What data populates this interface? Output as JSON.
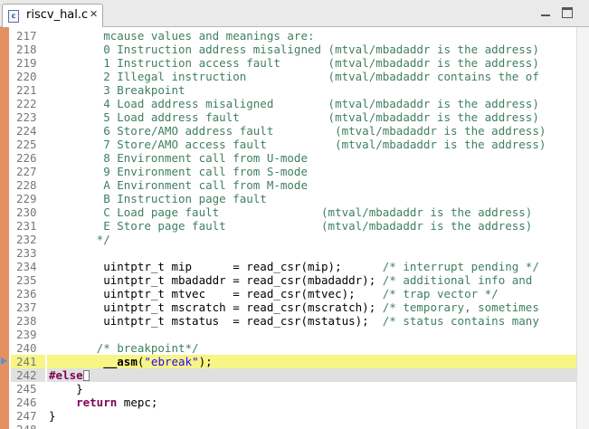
{
  "tab": {
    "title": "riscv_hal.c",
    "close_glyph": "✕"
  },
  "window": {
    "minimize": "minimize-icon",
    "maximize": "maximize-icon"
  },
  "editor": {
    "lines": [
      {
        "num": "217",
        "spans": [
          {
            "t": "        mcause values and meanings are:",
            "c": "comment"
          }
        ]
      },
      {
        "num": "218",
        "spans": [
          {
            "t": "        0 Instruction address misaligned (mtval/mbadaddr is the address)",
            "c": "comment"
          }
        ]
      },
      {
        "num": "219",
        "spans": [
          {
            "t": "        1 Instruction access fault       (mtval/mbadaddr is the address)",
            "c": "comment"
          }
        ]
      },
      {
        "num": "220",
        "spans": [
          {
            "t": "        2 Illegal instruction            (mtval/mbadaddr contains the of",
            "c": "comment"
          }
        ]
      },
      {
        "num": "221",
        "spans": [
          {
            "t": "        3 Breakpoint",
            "c": "comment"
          }
        ]
      },
      {
        "num": "222",
        "spans": [
          {
            "t": "        4 Load address misaligned        (mtval/mbadaddr is the address)",
            "c": "comment"
          }
        ]
      },
      {
        "num": "223",
        "spans": [
          {
            "t": "        5 Load address fault             (mtval/mbadaddr is the address)",
            "c": "comment"
          }
        ]
      },
      {
        "num": "224",
        "spans": [
          {
            "t": "        6 Store/AMO address fault         (mtval/mbadaddr is the address)",
            "c": "comment"
          }
        ]
      },
      {
        "num": "225",
        "spans": [
          {
            "t": "        7 Store/AMO access fault          (mtval/mbadaddr is the address)",
            "c": "comment"
          }
        ]
      },
      {
        "num": "226",
        "spans": [
          {
            "t": "        8 Environment call from U-mode",
            "c": "comment"
          }
        ]
      },
      {
        "num": "227",
        "spans": [
          {
            "t": "        9 Environment call from S-mode",
            "c": "comment"
          }
        ]
      },
      {
        "num": "228",
        "spans": [
          {
            "t": "        A Environment call from M-mode",
            "c": "comment"
          }
        ]
      },
      {
        "num": "229",
        "spans": [
          {
            "t": "        B Instruction page fault",
            "c": "comment"
          }
        ]
      },
      {
        "num": "230",
        "spans": [
          {
            "t": "        C Load page fault               (mtval/mbadaddr is the address)",
            "c": "comment"
          }
        ]
      },
      {
        "num": "231",
        "spans": [
          {
            "t": "        E Store page fault              (mtval/mbadaddr is the address)",
            "c": "comment"
          }
        ]
      },
      {
        "num": "232",
        "spans": [
          {
            "t": "       */",
            "c": "comment"
          }
        ]
      },
      {
        "num": "233",
        "spans": [
          {
            "t": "",
            "c": ""
          }
        ]
      },
      {
        "num": "234",
        "spans": [
          {
            "t": "        uintptr_t mip      = read_csr(mip);      ",
            "c": ""
          },
          {
            "t": "/* interrupt pending */",
            "c": "comment"
          }
        ]
      },
      {
        "num": "235",
        "spans": [
          {
            "t": "        uintptr_t mbadaddr = read_csr(mbadaddr); ",
            "c": ""
          },
          {
            "t": "/* additional info and",
            "c": "comment"
          }
        ]
      },
      {
        "num": "236",
        "spans": [
          {
            "t": "        uintptr_t mtvec    = read_csr(mtvec);    ",
            "c": ""
          },
          {
            "t": "/* trap vector */",
            "c": "comment"
          }
        ]
      },
      {
        "num": "237",
        "spans": [
          {
            "t": "        uintptr_t mscratch = read_csr(mscratch); ",
            "c": ""
          },
          {
            "t": "/* temporary, sometimes",
            "c": "comment"
          }
        ]
      },
      {
        "num": "238",
        "spans": [
          {
            "t": "        uintptr_t mstatus  = read_csr(mstatus);  ",
            "c": ""
          },
          {
            "t": "/* status contains many",
            "c": "comment"
          }
        ]
      },
      {
        "num": "239",
        "spans": [
          {
            "t": "",
            "c": ""
          }
        ]
      },
      {
        "num": "240",
        "spans": [
          {
            "t": "       /* breakpoint*/",
            "c": "comment"
          }
        ]
      },
      {
        "num": "241",
        "hl": true,
        "arrow": true,
        "spans": [
          {
            "t": "        ",
            "c": ""
          },
          {
            "t": "__asm",
            "c": "fn"
          },
          {
            "t": "(",
            "c": ""
          },
          {
            "t": "\"ebreak\"",
            "c": "str"
          },
          {
            "t": ");",
            "c": ""
          }
        ]
      },
      {
        "num": "242",
        "sel": true,
        "fold": true,
        "spans": [
          {
            "t": "#else",
            "c": "kw"
          },
          {
            "t": "[]",
            "c": "box"
          }
        ]
      },
      {
        "num": "245",
        "spans": [
          {
            "t": "    }",
            "c": ""
          }
        ]
      },
      {
        "num": "246",
        "spans": [
          {
            "t": "    ",
            "c": ""
          },
          {
            "t": "return",
            "c": "kw"
          },
          {
            "t": " mepc;",
            "c": ""
          }
        ]
      },
      {
        "num": "247",
        "spans": [
          {
            "t": "}",
            "c": ""
          }
        ]
      },
      {
        "num": "248",
        "spans": [
          {
            "t": "",
            "c": ""
          }
        ]
      }
    ]
  },
  "colors": {
    "current_line": "#f6f586",
    "comment": "#3f7f5f",
    "keyword": "#7f0055",
    "string": "#2a00ff",
    "change_strip": "#e39163"
  }
}
